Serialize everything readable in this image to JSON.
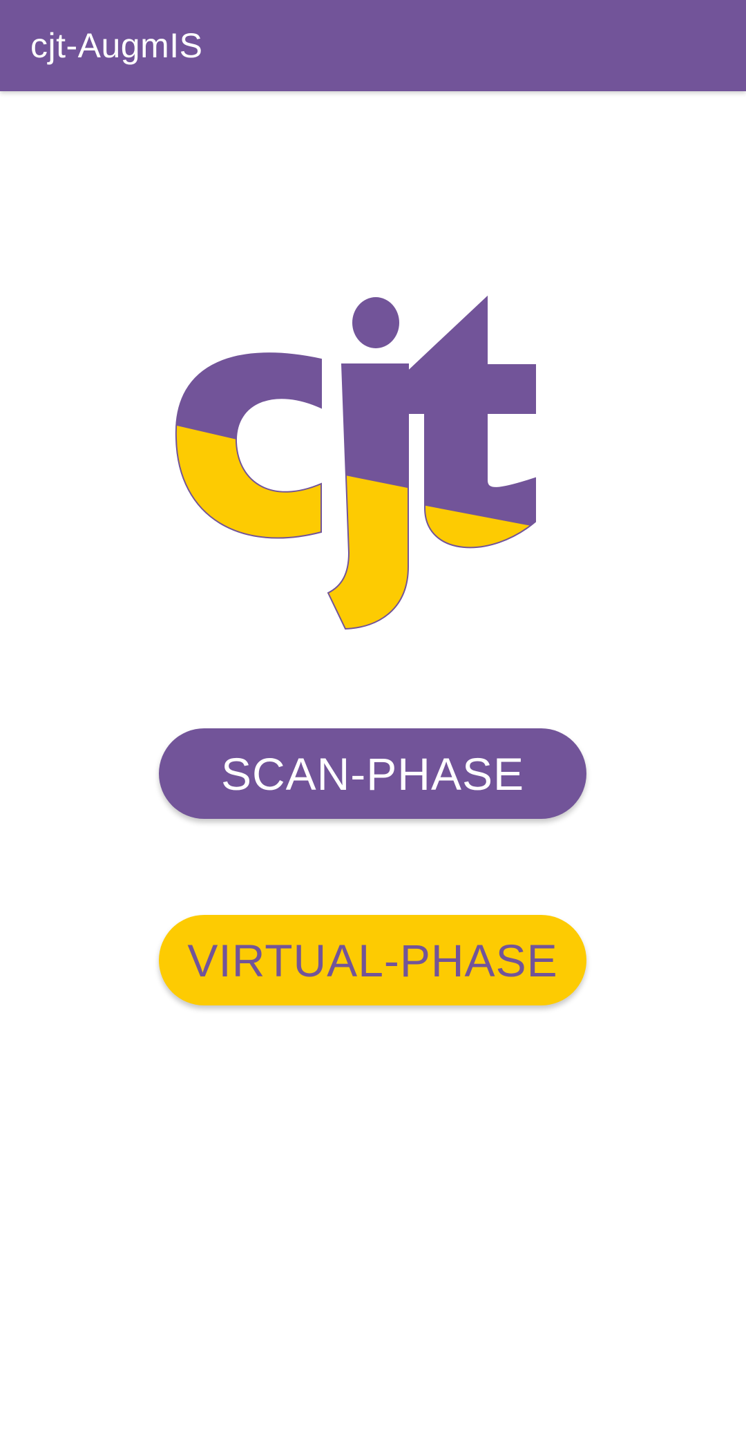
{
  "app_bar": {
    "title": "cjt-AugmIS"
  },
  "logo": {
    "text": "cjt",
    "colors": {
      "purple": "#725499",
      "yellow": "#FDCB02"
    }
  },
  "buttons": {
    "scan_label": "SCAN-PHASE",
    "virtual_label": "VIRTUAL-PHASE"
  },
  "colors": {
    "primary": "#725499",
    "accent": "#FDCB02",
    "background": "#FFFFFF"
  }
}
